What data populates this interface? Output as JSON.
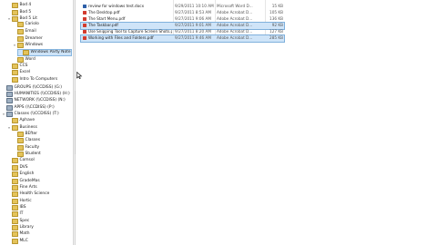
{
  "tree": [
    {
      "label": "Bod 4",
      "kind": "folder",
      "depth": 1,
      "expand": "",
      "sel": false
    },
    {
      "label": "Bod 5",
      "kind": "folder",
      "depth": 1,
      "expand": "",
      "sel": false
    },
    {
      "label": "Bod 5 Lit",
      "kind": "folder",
      "depth": 1,
      "expand": "▾",
      "sel": false
    },
    {
      "label": "Cariolo",
      "kind": "folder",
      "depth": 2,
      "expand": "",
      "sel": false
    },
    {
      "label": "Email",
      "kind": "folder",
      "depth": 2,
      "expand": "",
      "sel": false
    },
    {
      "label": "Dreamer",
      "kind": "folder",
      "depth": 2,
      "expand": "",
      "sel": false
    },
    {
      "label": "Windows",
      "kind": "folder",
      "depth": 2,
      "expand": "▾",
      "sel": false
    },
    {
      "label": "Windows Party Note",
      "kind": "folder",
      "depth": 3,
      "expand": "",
      "sel": true
    },
    {
      "label": "Word",
      "kind": "folder",
      "depth": 2,
      "expand": "",
      "sel": false
    },
    {
      "label": "CCS",
      "kind": "folder",
      "depth": 1,
      "expand": "",
      "sel": false
    },
    {
      "label": "Excel",
      "kind": "folder",
      "depth": 1,
      "expand": "",
      "sel": false
    },
    {
      "label": "Intro To Computers",
      "kind": "folder",
      "depth": 1,
      "expand": "",
      "sel": false
    },
    {
      "label": "GROUPS (\\\\CCDISS) (G:)",
      "kind": "net",
      "depth": 0,
      "expand": "",
      "sel": false
    },
    {
      "label": "HUMANITIES (\\\\CCDISS) (H:)",
      "kind": "net",
      "depth": 0,
      "expand": "",
      "sel": false
    },
    {
      "label": "NETWORK (\\\\CCDISS) (N:)",
      "kind": "net",
      "depth": 0,
      "expand": "",
      "sel": false
    },
    {
      "label": "APPS (\\\\CCDISS) (P:)",
      "kind": "net",
      "depth": 0,
      "expand": "",
      "sel": false
    },
    {
      "label": "Classes (\\\\CCDISS) (T:)",
      "kind": "net",
      "depth": 0,
      "expand": "▾",
      "sel": false
    },
    {
      "label": "Aphave",
      "kind": "folder",
      "depth": 1,
      "expand": "",
      "sel": false
    },
    {
      "label": "Business",
      "kind": "folder",
      "depth": 1,
      "expand": "▾",
      "sel": false
    },
    {
      "label": "BEfter",
      "kind": "folder",
      "depth": 2,
      "expand": "",
      "sel": false
    },
    {
      "label": "Classes",
      "kind": "folder",
      "depth": 2,
      "expand": "",
      "sel": false
    },
    {
      "label": "Faculty",
      "kind": "folder",
      "depth": 2,
      "expand": "",
      "sel": false
    },
    {
      "label": "Student",
      "kind": "folder",
      "depth": 2,
      "expand": "",
      "sel": false
    },
    {
      "label": "Comsol",
      "kind": "folder",
      "depth": 1,
      "expand": "",
      "sel": false
    },
    {
      "label": "DVS",
      "kind": "folder",
      "depth": 1,
      "expand": "",
      "sel": false
    },
    {
      "label": "English",
      "kind": "folder",
      "depth": 1,
      "expand": "",
      "sel": false
    },
    {
      "label": "GradeMas",
      "kind": "folder",
      "depth": 1,
      "expand": "",
      "sel": false
    },
    {
      "label": "Fine Arts",
      "kind": "folder",
      "depth": 1,
      "expand": "",
      "sel": false
    },
    {
      "label": "Health Science",
      "kind": "folder",
      "depth": 1,
      "expand": "",
      "sel": false
    },
    {
      "label": "Hortic",
      "kind": "folder",
      "depth": 1,
      "expand": "",
      "sel": false
    },
    {
      "label": "IBS",
      "kind": "folder",
      "depth": 1,
      "expand": "",
      "sel": false
    },
    {
      "label": "IT",
      "kind": "folder",
      "depth": 1,
      "expand": "",
      "sel": false
    },
    {
      "label": "Spec",
      "kind": "folder",
      "depth": 1,
      "expand": "",
      "sel": false
    },
    {
      "label": "Library",
      "kind": "folder",
      "depth": 1,
      "expand": "",
      "sel": false
    },
    {
      "label": "Math",
      "kind": "folder",
      "depth": 1,
      "expand": "",
      "sel": false
    },
    {
      "label": "MLC",
      "kind": "folder",
      "depth": 1,
      "expand": "",
      "sel": false
    }
  ],
  "files": [
    {
      "name": "review for windows test.docx",
      "date": "9/29/2011 10:10 AM",
      "type": "Microsoft Word D...",
      "size": "15 KB",
      "kind": "doc",
      "sel": false
    },
    {
      "name": "The Desktop.pdf",
      "date": "9/27/2011 8:53 AM",
      "type": "Adobe Acrobat D...",
      "size": "105 KB",
      "kind": "pdf",
      "sel": false
    },
    {
      "name": "The Start Menu.pdf",
      "date": "9/27/2011 9:06 AM",
      "type": "Adobe Acrobat D...",
      "size": "136 KB",
      "kind": "pdf",
      "sel": false
    },
    {
      "name": "The Taskbar.pdf",
      "date": "9/27/2011 9:01 AM",
      "type": "Adobe Acrobat D...",
      "size": "92 KB",
      "kind": "pdf",
      "sel": true
    },
    {
      "name": "Use Snipping Tool to Capture Screen Shots.pdf",
      "date": "9/27/2011 8:20 AM",
      "type": "Adobe Acrobat D...",
      "size": "127 KB",
      "kind": "pdf",
      "sel": false
    },
    {
      "name": "Working with Files and Folders.pdf",
      "date": "9/27/2011 9:46 AM",
      "type": "Adobe Acrobat D...",
      "size": "285 KB",
      "kind": "pdf",
      "sel": true
    }
  ],
  "colors": {
    "selection": "#cfe4f8",
    "folder": "#e4c35a",
    "pdf": "#d23b2e",
    "doc": "#2d5fa8"
  },
  "icons": {
    "folder": "folder-icon",
    "drive": "drive-icon",
    "net": "network-drive-icon",
    "pdf": "pdf-file-icon",
    "doc": "word-doc-icon",
    "cursor": "mouse-pointer-icon"
  }
}
